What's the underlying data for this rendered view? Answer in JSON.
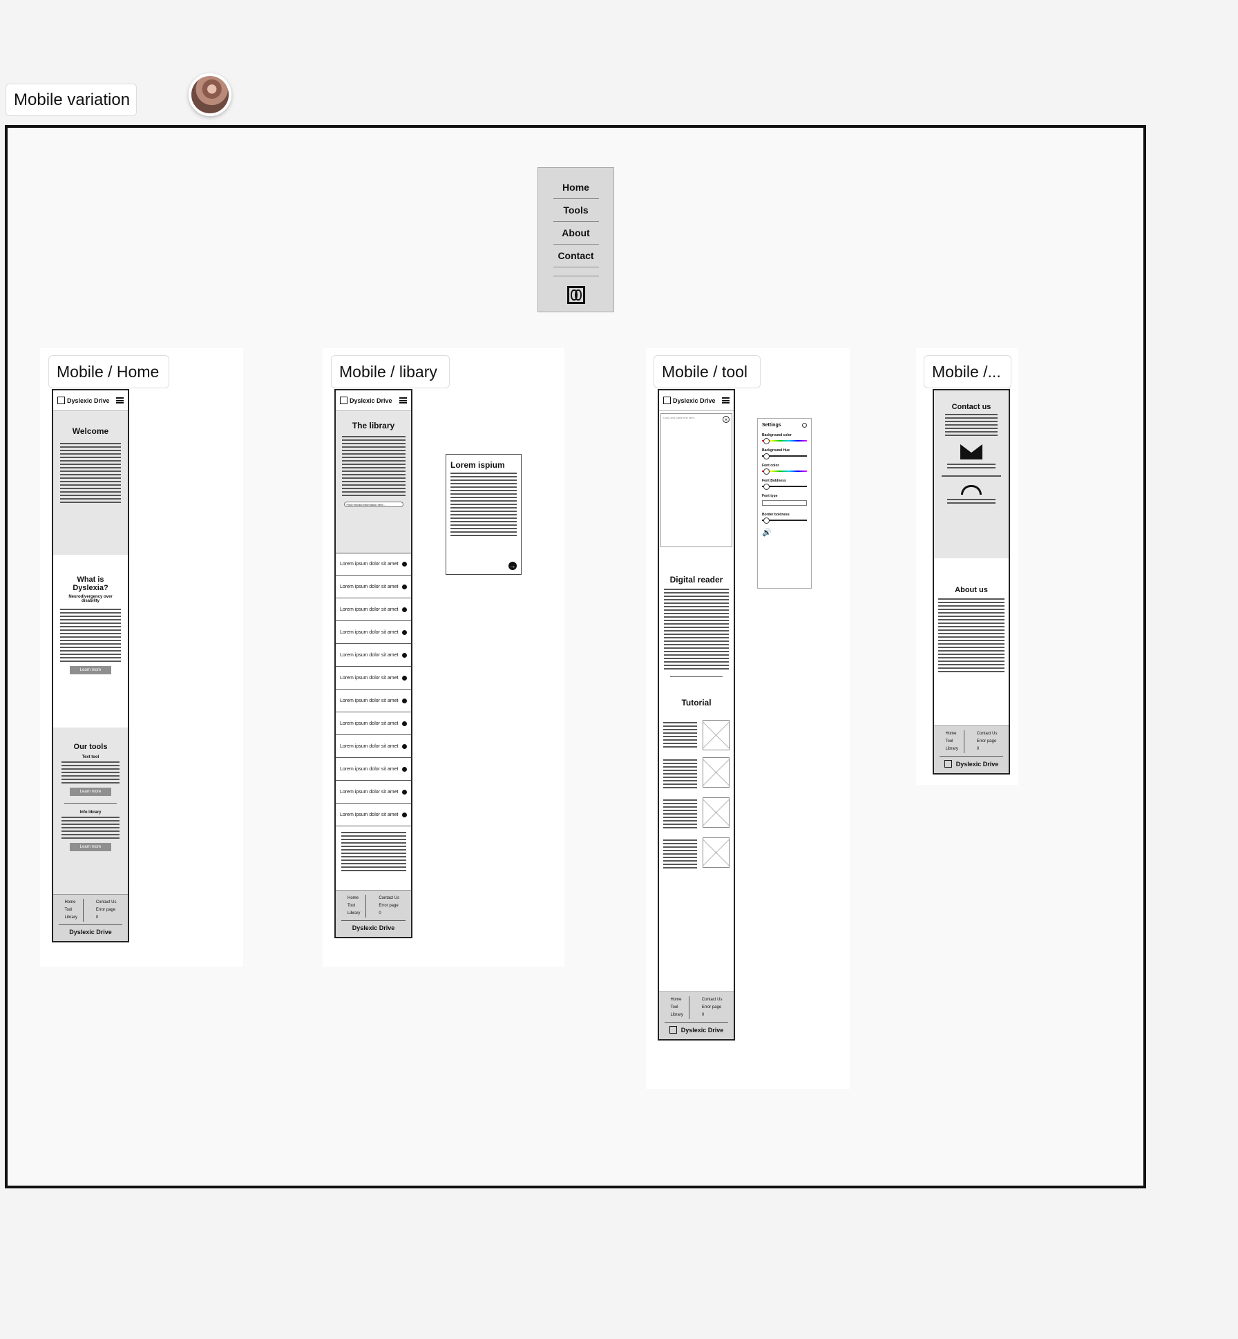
{
  "canvas": {
    "section_label": "Mobile variation"
  },
  "nav_menu": {
    "items": [
      "Home",
      "Tools",
      "About",
      "Contact"
    ]
  },
  "frames": {
    "home_title": "Mobile / Home",
    "library_title": "Mobile / libary",
    "tool_title": "Mobile / tool",
    "contact_title": "Mobile /..."
  },
  "phone": {
    "brand": "Dyslexic Drive",
    "footer": {
      "col1": [
        "Home",
        "Tool",
        "Library"
      ],
      "col2": [
        "Contact Us",
        "Error page",
        "0"
      ],
      "brand": "Dyslexic Drive"
    }
  },
  "home": {
    "welcome_heading": "Welcome",
    "dyslexia_heading": "What is Dyslexia?",
    "dyslexia_sub": "Neurodivergency over disability",
    "learn_more": "Learn more",
    "tools_heading": "Our tools",
    "text_tool": "Text tool",
    "info_library": "Info library"
  },
  "library": {
    "heading": "The library",
    "search_placeholder": "Find relevant information here...",
    "row_label": "Lorem ipsum dolor sit amet",
    "row_count": 12,
    "popup_title": "Lorem ispium"
  },
  "tool": {
    "reader_placeholder": "Copy and paste text here...",
    "reader_heading": "Digital reader",
    "tutorial_heading": "Tutorial",
    "settings": {
      "title": "Settings",
      "items": [
        "Background color",
        "Background Hue",
        "Font color",
        "Font Boldness",
        "Font type",
        "Border boldness"
      ]
    }
  },
  "contact": {
    "contact_heading": "Contact us",
    "about_heading": "About us"
  }
}
